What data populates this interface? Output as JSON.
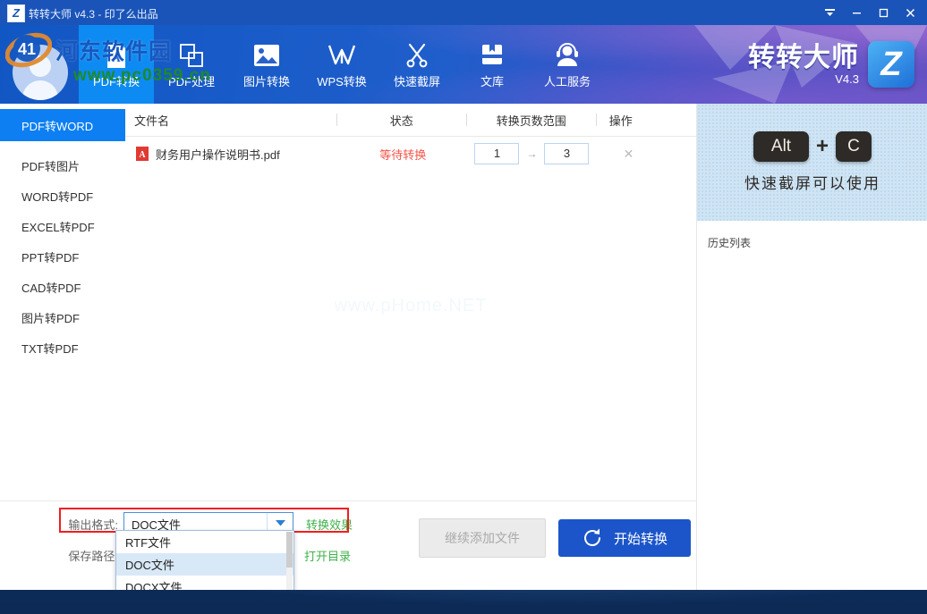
{
  "titlebar": {
    "logo_letter": "Z",
    "title": "转转大师 v4.3 - 印了么出品",
    "controls": [
      {
        "name": "tray-icon",
        "glyph": "▼"
      },
      {
        "name": "minimize-button",
        "glyph": "—"
      },
      {
        "name": "maximize-button",
        "glyph": "▢"
      },
      {
        "name": "close-button",
        "glyph": "✕"
      }
    ]
  },
  "header": {
    "nav": [
      {
        "label": "PDF转换",
        "icon": "pdf-file-icon",
        "active": true
      },
      {
        "label": "PDF处理",
        "icon": "two-squares-icon",
        "active": false
      },
      {
        "label": "图片转换",
        "icon": "picture-icon",
        "active": false
      },
      {
        "label": "WPS转换",
        "icon": "wps-w-icon",
        "active": false
      },
      {
        "label": "快速截屏",
        "icon": "scissors-icon",
        "active": false
      },
      {
        "label": "文库",
        "icon": "book-icon",
        "active": false
      },
      {
        "label": "人工服务",
        "icon": "headset-person-icon",
        "active": false
      }
    ],
    "brand_name": "转转大师",
    "brand_version": "V4.3",
    "brand_badge": "Z"
  },
  "sidebar": {
    "items": [
      {
        "label": "PDF转WORD",
        "active": true
      },
      {
        "label": "PDF转图片",
        "active": false
      },
      {
        "label": "WORD转PDF",
        "active": false
      },
      {
        "label": "EXCEL转PDF",
        "active": false
      },
      {
        "label": "PPT转PDF",
        "active": false
      },
      {
        "label": "CAD转PDF",
        "active": false
      },
      {
        "label": "图片转PDF",
        "active": false
      },
      {
        "label": "TXT转PDF",
        "active": false
      }
    ]
  },
  "file_list": {
    "columns": [
      "文件名",
      "状态",
      "转换页数范围",
      "操作"
    ],
    "rows": [
      {
        "filename": "财务用户操作说明书.pdf",
        "status": "等待转换",
        "page_start": "1",
        "page_arrow": "→",
        "page_end": "3",
        "delete_glyph": "✕"
      }
    ],
    "watermark": "www.pHome.NET"
  },
  "right_panel": {
    "ad": {
      "key1": "Alt",
      "plus": "+",
      "key2": "C",
      "text": "快速截屏可以使用"
    },
    "history_label": "历史列表"
  },
  "footer": {
    "format_label": "输出格式:",
    "format_value": "DOC文件",
    "format_caret": "▼",
    "convert_effect_link": "转换效果",
    "path_label": "保存路径:",
    "path_value": "",
    "open_dir_link": "打开目录",
    "add_file_button": "继续添加文件",
    "start_button": "开始转换",
    "dropdown_options": [
      {
        "label": "RTF文件",
        "selected": false
      },
      {
        "label": "DOC文件",
        "selected": true
      },
      {
        "label": "DOCX文件",
        "selected": false
      }
    ]
  },
  "watermark": {
    "site_name": "河东软件园",
    "site_url": "www.pc0359.cn"
  },
  "colors": {
    "accent_blue": "#0d8bf2",
    "header_blue": "#1f5ecb",
    "primary_button": "#1b55c9",
    "status_red": "#f4554a",
    "link_green": "#3fb24a",
    "highlight_red": "#f01e1e"
  }
}
